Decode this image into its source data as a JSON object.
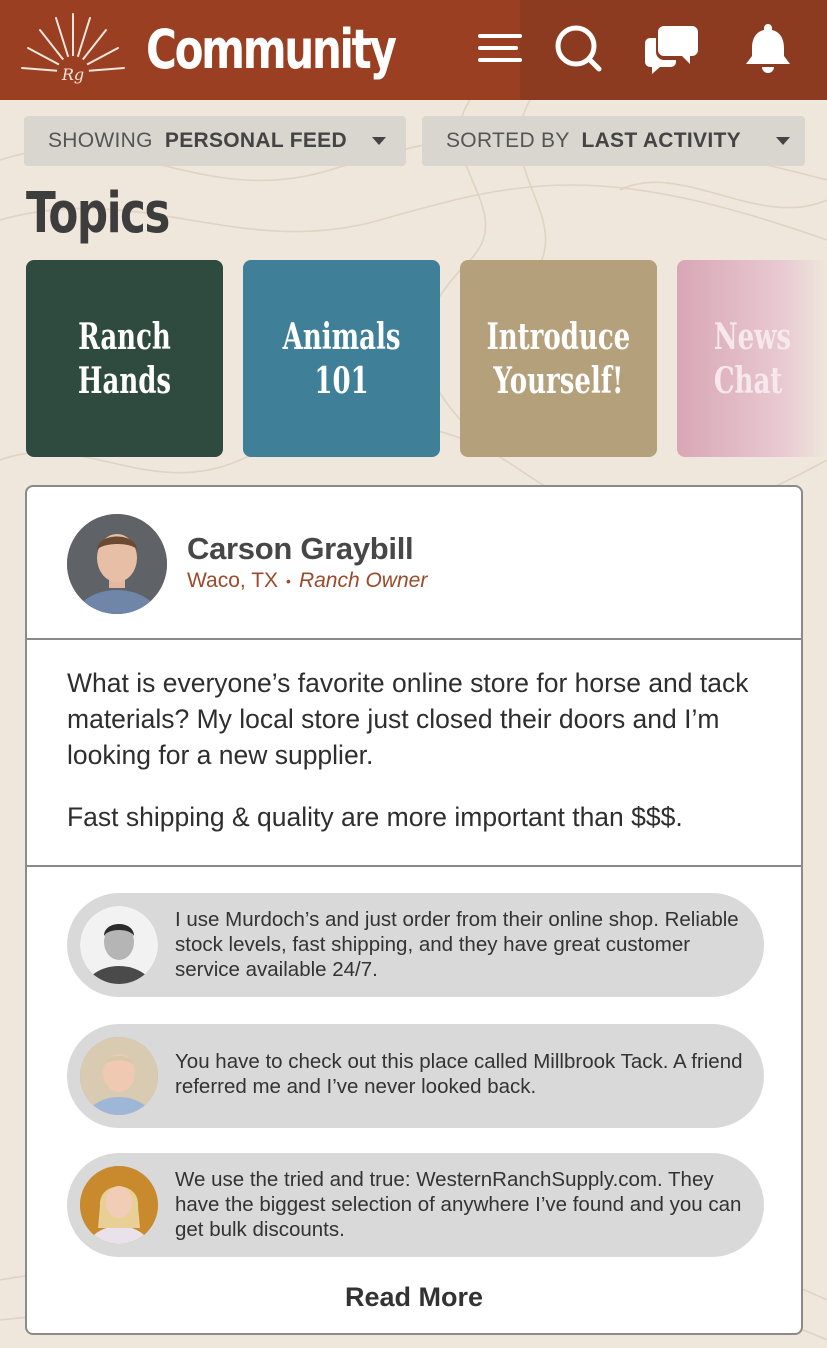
{
  "header": {
    "title": "Community",
    "logo_text": "Rg",
    "icons": [
      "menu-icon",
      "search-icon",
      "chat-bubbles-icon",
      "bell-icon"
    ]
  },
  "filters": {
    "feed": {
      "prefix": "SHOWING",
      "value": "PERSONAL FEED"
    },
    "sort": {
      "prefix": "SORTED BY",
      "value": "LAST ACTIVITY"
    }
  },
  "topics": {
    "heading": "Topics",
    "tiles": [
      {
        "line1": "Ranch",
        "line2": "Hands",
        "color": "#2f4a3e"
      },
      {
        "line1": "Animals",
        "line2": "101",
        "color": "#3f7f98"
      },
      {
        "line1": "Introduce",
        "line2": "Yourself!",
        "color": "#b5a07c"
      },
      {
        "line1": "News",
        "line2": "Chat",
        "color": "#d9a6b6"
      }
    ]
  },
  "post": {
    "author": "Carson Graybill",
    "location": "Waco, TX",
    "role": "Ranch Owner",
    "body": [
      "What is everyone’s favorite online store for horse and tack materials? My local store just closed their doors and I’m looking for a new supplier.",
      "Fast shipping & quality are more important than $$$."
    ],
    "comments": [
      {
        "text": "I use Murdoch’s and just order from their online shop. Reliable stock levels, fast shipping, and they have great customer service available 24/7."
      },
      {
        "text": "You have to check out this place called Millbrook Tack. A friend referred me and I’ve never looked back."
      },
      {
        "text": "We use the tried and true: WesternRanchSupply.com. They have the biggest selection of anywhere I’ve found and you can get bulk discounts."
      }
    ],
    "read_more": "Read More"
  },
  "colors": {
    "header": "#9a3f22",
    "background": "#efe7dc",
    "accent_text": "#9b4a2b"
  }
}
